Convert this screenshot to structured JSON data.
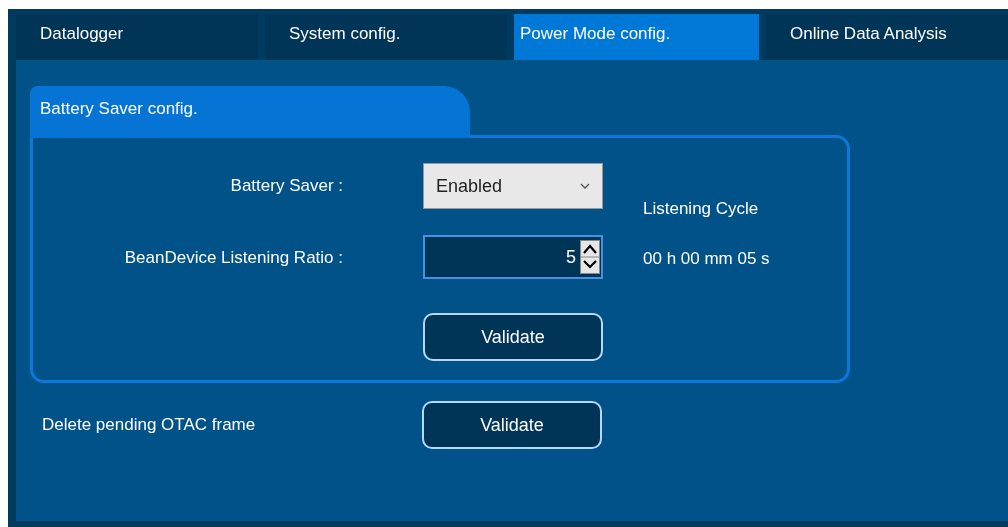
{
  "tabs": [
    {
      "label": "Datalogger",
      "selected": false
    },
    {
      "label": "System config.",
      "selected": false
    },
    {
      "label": "Power Mode config.",
      "selected": true
    },
    {
      "label": "Online Data Analysis",
      "selected": false
    }
  ],
  "battery_saver_group": {
    "title": "Battery Saver config.",
    "battery_saver": {
      "label": "Battery Saver :",
      "value": "Enabled"
    },
    "listening_ratio": {
      "label": "BeanDevice Listening Ratio :",
      "value": "5"
    },
    "listening_cycle": {
      "label": "Listening Cycle",
      "value": "00 h 00 mm 05 s"
    },
    "validate_button": "Validate"
  },
  "delete_otac": {
    "label": "Delete pending OTAC frame",
    "button": "Validate"
  }
}
